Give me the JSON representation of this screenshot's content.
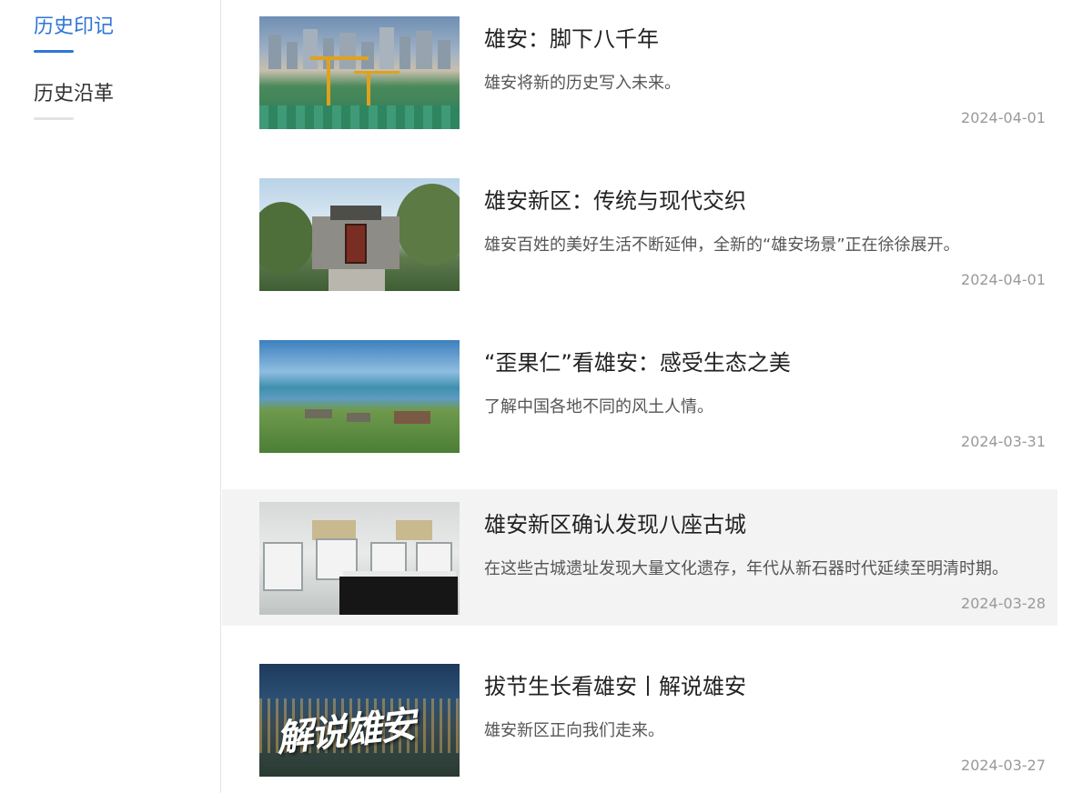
{
  "sidebar": {
    "items": [
      {
        "label": "历史印记",
        "active": true
      },
      {
        "label": "历史沿革",
        "active": false
      }
    ]
  },
  "articles": [
    {
      "title": "雄安：脚下八千年",
      "desc": "雄安将新的历史写入未来。",
      "date": "2024-04-01",
      "image_label": "construction-site-skyline"
    },
    {
      "title": "雄安新区：传统与现代交织",
      "desc": "雄安百姓的美好生活不断延伸，全新的“雄安场景”正在徐徐展开。",
      "date": "2024-04-01",
      "image_label": "traditional-gate"
    },
    {
      "title": "“歪果仁”看雄安：感受生态之美",
      "desc": "了解中国各地不同的风土人情。",
      "date": "2024-03-31",
      "image_label": "lake-landscape"
    },
    {
      "title": "雄安新区确认发现八座古城",
      "desc": "在这些古城遗址发现大量文化遗存，年代从新石器时代延续至明清时期。",
      "date": "2024-03-28",
      "image_label": "exhibition-hall",
      "highlighted": true
    },
    {
      "title": "拔节生长看雄安丨解说雄安",
      "desc": "雄安新区正向我们走来。",
      "date": "2024-03-27",
      "image_label": "night-city-aerial",
      "overlay": "解说雄安"
    }
  ],
  "colors": {
    "accent": "#2f76d6",
    "hover_bg": "#f3f3f3",
    "date": "#999999"
  }
}
